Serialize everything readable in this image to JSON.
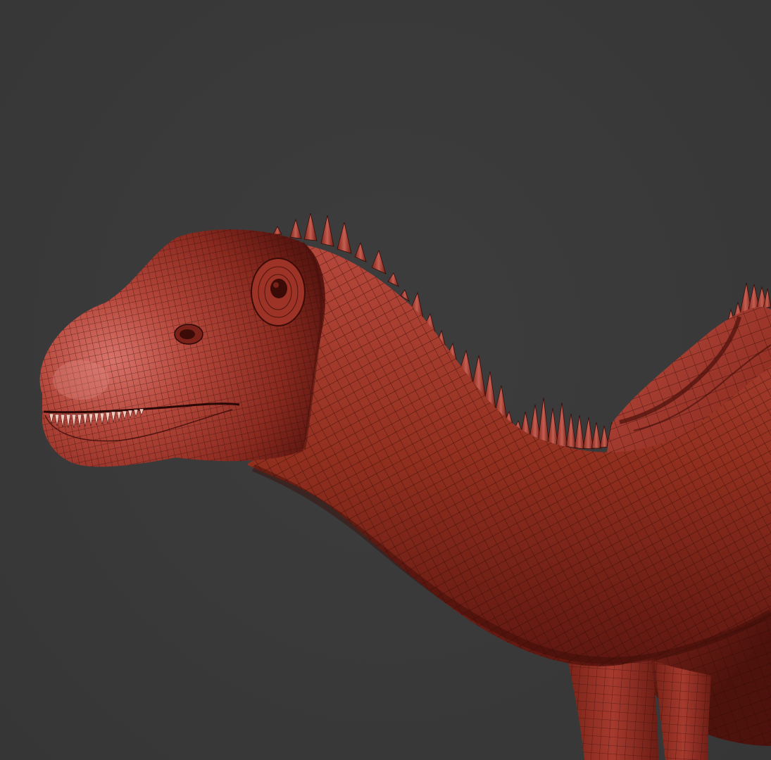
{
  "viewport": {
    "background_color": "#3a3a3a",
    "content": "3d-wireframe-mesh"
  },
  "model": {
    "subject": "sauropod-dinosaur",
    "render_style": "wireframe-over-shaded",
    "base_color": "#9c2e22",
    "highlight_color": "#d4645a",
    "shadow_color": "#4a0f0b",
    "wire_color": "#2a0806"
  }
}
